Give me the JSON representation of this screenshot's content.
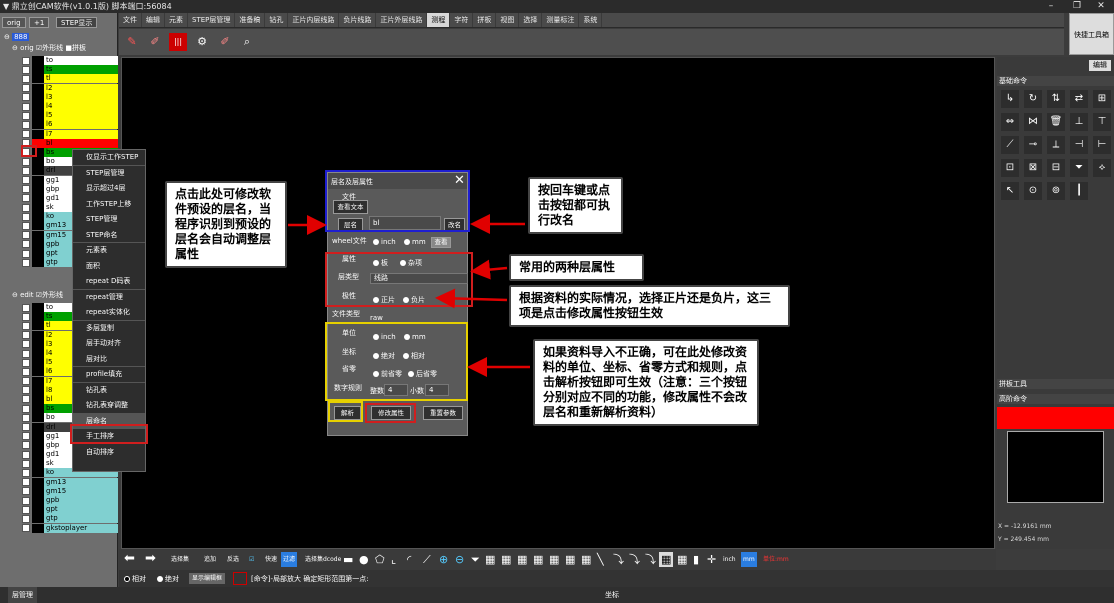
{
  "window": {
    "title": "鼎立创CAM软件(v1.0.1版) 脚本端口:56084"
  },
  "left_panel": {
    "tabs": [
      "orig",
      "+1",
      "STEP显示"
    ],
    "tree_root": "888",
    "group_orig": {
      "label": "orig",
      "opt1": "外形线",
      "opt2": "拼板"
    },
    "group_edit": {
      "label": "edit",
      "opt1": "外形线"
    },
    "orig_layers": [
      {
        "name": "to",
        "color": "#000000",
        "bg": "#ffffff"
      },
      {
        "name": "ts",
        "color": "#000000",
        "bg": "#00a000"
      },
      {
        "name": "tl",
        "color": "#000000",
        "bg": "#ffff00"
      },
      {
        "name": "l2",
        "color": "#000000",
        "bg": "#ffff00"
      },
      {
        "name": "l3",
        "color": "#000000",
        "bg": "#ffff00"
      },
      {
        "name": "l4",
        "color": "#000000",
        "bg": "#ffff00"
      },
      {
        "name": "l5",
        "color": "#000000",
        "bg": "#ffff00"
      },
      {
        "name": "l6",
        "color": "#000000",
        "bg": "#ffff00"
      },
      {
        "name": "l7",
        "color": "#000000",
        "bg": "#ffff00"
      },
      {
        "name": "bl",
        "color": "#ff0000",
        "bg": "#ff0000"
      },
      {
        "name": "bs",
        "color": "#000000",
        "bg": "#00a000"
      },
      {
        "name": "bo",
        "color": "#000000",
        "bg": "#ffffff"
      },
      {
        "name": "drl",
        "color": "#000000",
        "bg": "#404040"
      },
      {
        "name": "gg1",
        "color": "#000000",
        "bg": "#ffffff"
      },
      {
        "name": "gbp",
        "color": "#000000",
        "bg": "#ffffff"
      },
      {
        "name": "gd1",
        "color": "#000000",
        "bg": "#ffffff"
      },
      {
        "name": "sk",
        "color": "#000000",
        "bg": "#ffffff"
      },
      {
        "name": "ko",
        "color": "#000000",
        "bg": "#80d0d0"
      },
      {
        "name": "gm13",
        "color": "#000000",
        "bg": "#80d0d0"
      },
      {
        "name": "gm15",
        "color": "#000000",
        "bg": "#80d0d0"
      },
      {
        "name": "gpb",
        "color": "#000000",
        "bg": "#80d0d0"
      },
      {
        "name": "gpt",
        "color": "#000000",
        "bg": "#80d0d0"
      },
      {
        "name": "gtp",
        "color": "#000000",
        "bg": "#80d0d0"
      }
    ],
    "edit_layers": [
      {
        "name": "to",
        "color": "#000000",
        "bg": "#ffffff"
      },
      {
        "name": "ts",
        "color": "#000000",
        "bg": "#00a000"
      },
      {
        "name": "tl",
        "color": "#000000",
        "bg": "#ffff00"
      },
      {
        "name": "l2",
        "color": "#000000",
        "bg": "#ffff00"
      },
      {
        "name": "l3",
        "color": "#000000",
        "bg": "#ffff00"
      },
      {
        "name": "l4",
        "color": "#000000",
        "bg": "#ffff00"
      },
      {
        "name": "l5",
        "color": "#000000",
        "bg": "#ffff00"
      },
      {
        "name": "l6",
        "color": "#000000",
        "bg": "#ffff00"
      },
      {
        "name": "l7",
        "color": "#000000",
        "bg": "#ffff00"
      },
      {
        "name": "l8",
        "color": "#000000",
        "bg": "#ffff00"
      },
      {
        "name": "bl",
        "color": "#000000",
        "bg": "#ffff00"
      },
      {
        "name": "bs",
        "color": "#000000",
        "bg": "#00a000"
      },
      {
        "name": "bo",
        "color": "#000000",
        "bg": "#ffffff"
      },
      {
        "name": "drl",
        "color": "#000000",
        "bg": "#404040"
      },
      {
        "name": "gg1",
        "color": "#000000",
        "bg": "#ffffff"
      },
      {
        "name": "gbp",
        "color": "#000000",
        "bg": "#ffffff"
      },
      {
        "name": "gd1",
        "color": "#000000",
        "bg": "#ffffff"
      },
      {
        "name": "sk",
        "color": "#000000",
        "bg": "#ffffff"
      },
      {
        "name": "ko",
        "color": "#000000",
        "bg": "#80d0d0"
      },
      {
        "name": "gm13",
        "color": "#000000",
        "bg": "#80d0d0"
      },
      {
        "name": "gm15",
        "color": "#000000",
        "bg": "#80d0d0"
      },
      {
        "name": "gpb",
        "color": "#000000",
        "bg": "#80d0d0"
      },
      {
        "name": "gpt",
        "color": "#000000",
        "bg": "#80d0d0"
      },
      {
        "name": "gtp",
        "color": "#000000",
        "bg": "#80d0d0"
      },
      {
        "name": "gkstoplayer",
        "color": "#000000",
        "bg": "#80d0d0"
      }
    ]
  },
  "menu": [
    "文件",
    "编辑",
    "元素",
    "STEP层管理",
    "准备稿",
    "钻孔",
    "正片内层线路",
    "负片线路",
    "正片外层线路",
    "测程",
    "字符",
    "拼板",
    "视图",
    "选择",
    "测量标注",
    "系统"
  ],
  "menu_active": "测程",
  "quick_toolbar": "快捷工具箱",
  "context_menu": [
    "仅显示工作STEP",
    "STEP层管理",
    "显示超过4层",
    "工作STEP上移",
    "STEP管理",
    "STEP命名",
    "元素表",
    "面积",
    "repeat D码表",
    "repeat管理",
    "repeat实体化",
    "多层复制",
    "层手动对齐",
    "层对比",
    "profile填充",
    "钻孔表",
    "钻孔表穿调整",
    "层命名",
    "手工排序",
    "自动排序"
  ],
  "context_menu_selected": "层命名",
  "dialog": {
    "title": "层名及层属性",
    "file_label": "文件",
    "view_text_btn": "查看文本",
    "layername_btn": "层名",
    "layername_value": "bl",
    "rename_btn": "改名",
    "wheel_label": "wheel文件",
    "inch": "inch",
    "mm": "mm",
    "view_btn": "查看",
    "attr_label": "属性",
    "attr_opt1": "板",
    "attr_opt2": "杂项",
    "layertype_label": "层类型",
    "layertype_value": "线路",
    "polarity_label": "极性",
    "pol_opt1": "正片",
    "pol_opt2": "负片",
    "filetype_label": "文件类型",
    "filetype_value": "raw",
    "unit_label": "单位",
    "coord_label": "坐标",
    "coord_opt1": "绝对",
    "coord_opt2": "相对",
    "zero_label": "省零",
    "zero_opt1": "前省零",
    "zero_opt2": "后省零",
    "numfmt_label": "数字规则",
    "int_label": "整数",
    "int_value": "4",
    "dec_label": "小数",
    "dec_value": "4",
    "parse_btn": "解析",
    "modify_btn": "修改属性",
    "reset_btn": "重置参数"
  },
  "callouts": {
    "c1": "点击此处可修改软件预设的层名，当程序识别到预设的层名会自动调整层属性",
    "c2": "按回车键或点击按钮都可执行改名",
    "c3": "常用的两种层属性",
    "c4": "根据资料的实际情况，选择正片还是负片，这三项是点击修改属性按钮生效",
    "c5": "如果资料导入不正确，可在此处修改资料的单位、坐标、省零方式和规则，点击解析按钮即可生效（注意：三个按钮分别对应不同的功能，修改属性不会改层名和重新解析资料）"
  },
  "right_panel": {
    "edit_label": "编辑",
    "basic_header": "基础命令",
    "panel_tools": "拼板工具",
    "advanced": "高阶命令",
    "coord_x": "X = -12.9161 mm",
    "coord_y": "Y = 249.454 mm"
  },
  "bottom_toolbar": {
    "labels": [
      "选择集",
      "追加",
      "反选",
      "快速",
      "过滤",
      "选择集dcode",
      "inch",
      "mm"
    ],
    "units_status": "单位:mm"
  },
  "status": {
    "opt1": "相对",
    "opt2": "绝对",
    "btn": "显示编辑框",
    "cmd": "[命令]-局部放大 确定矩形范围第一点:"
  },
  "footer": {
    "left_tab": "层管理",
    "center": "坐标"
  }
}
